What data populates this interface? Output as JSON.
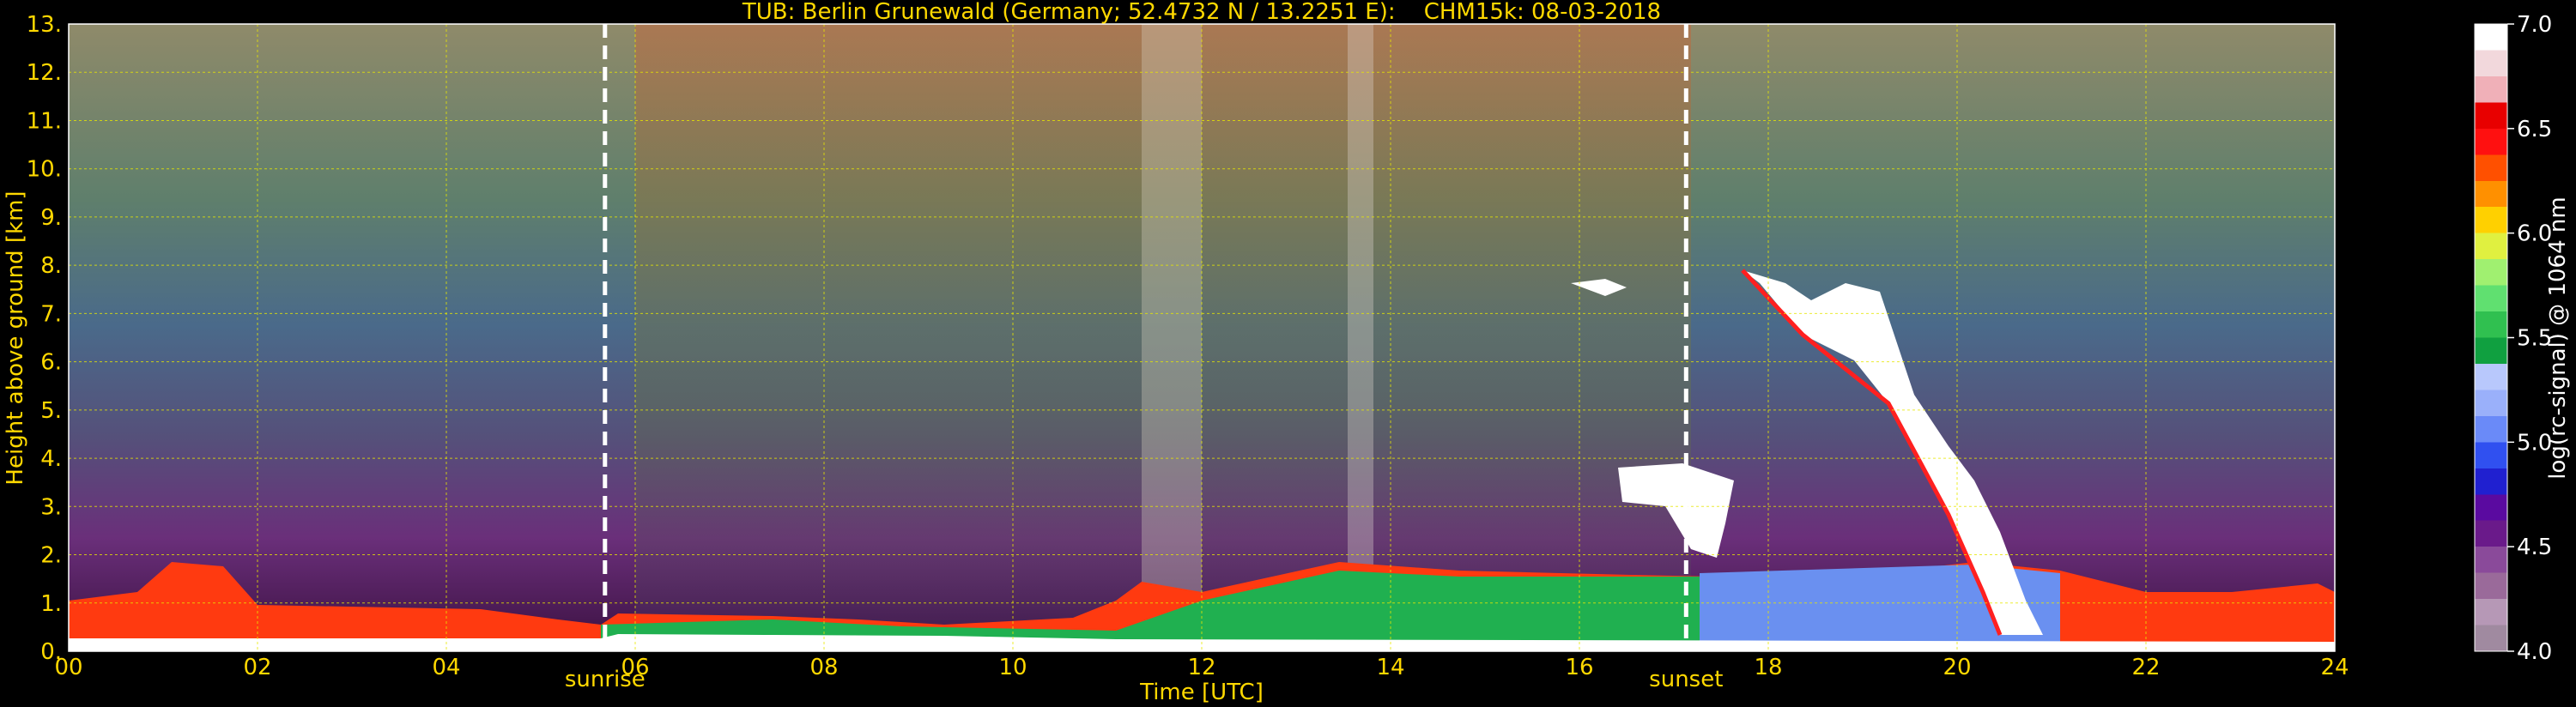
{
  "title": "TUB: Berlin Grunewald (Germany; 52.4732 N / 13.2251 E):    CHM15k: 08-03-2018",
  "chart_data": {
    "type": "heatmap",
    "title": "TUB: Berlin Grunewald (Germany; 52.4732 N / 13.2251 E):    CHM15k: 08-03-2018",
    "xlabel": "Time [UTC]",
    "ylabel": "Height above ground [km]",
    "xlim": [
      0,
      24
    ],
    "ylim": [
      0,
      13
    ],
    "x_ticks": [
      "00",
      "02",
      "04",
      "06",
      "08",
      "10",
      "12",
      "14",
      "16",
      "18",
      "20",
      "22",
      "24"
    ],
    "y_ticks": [
      "0.",
      "1.",
      "2.",
      "3.",
      "4.",
      "5.",
      "6.",
      "7.",
      "8.",
      "9.",
      "10.",
      "11.",
      "12.",
      "13."
    ],
    "grid": true,
    "colorbar": {
      "label": "log(rc-signal) @ 1064 nm",
      "range": [
        4.0,
        7.0
      ],
      "ticks": [
        "4.0",
        "4.5",
        "5.0",
        "5.5",
        "6.0",
        "6.5",
        "7.0"
      ],
      "colors": [
        "#a08aa0",
        "#b698b6",
        "#9a6a9a",
        "#8a4a9a",
        "#6a1a8a",
        "#5a0aa0",
        "#2020d0",
        "#3050f0",
        "#6a8af8",
        "#9ab0fa",
        "#b8c8fc",
        "#10a040",
        "#30c050",
        "#60e070",
        "#a0f070",
        "#e0f040",
        "#ffd000",
        "#ff9000",
        "#ff5000",
        "#ff1010",
        "#e80000",
        "#f0b0b8",
        "#f2d8dc",
        "#ffffff"
      ]
    },
    "markers": [
      {
        "label": "sunrise",
        "x": 5.68
      },
      {
        "label": "sunset",
        "x": 17.13
      }
    ]
  }
}
